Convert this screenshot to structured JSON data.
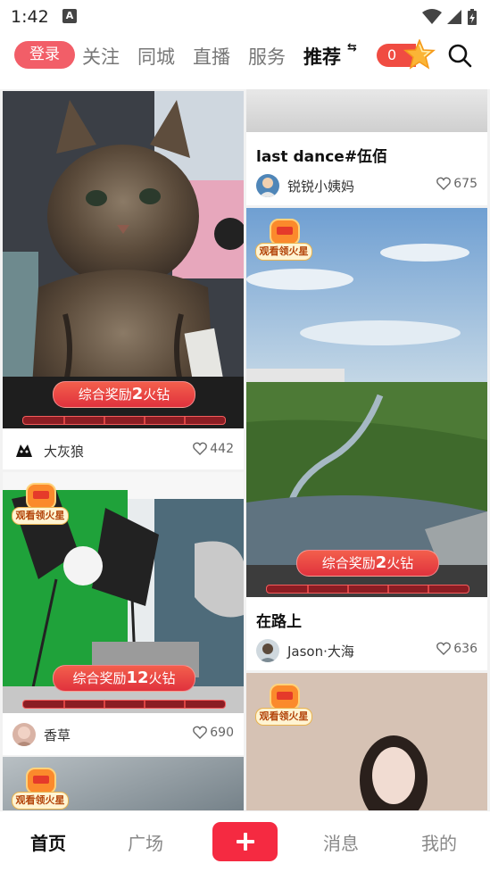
{
  "status_bar": {
    "time": "1:42",
    "notification_glyph": "A"
  },
  "top_nav": {
    "login": "登录",
    "tabs": [
      "关注",
      "同城",
      "直播",
      "服务",
      "推荐"
    ],
    "active_tab": "推荐",
    "swap_glyph": "⇆",
    "points": "0"
  },
  "feed": {
    "left": [
      {
        "reward": {
          "prefix": "综合奖励",
          "amount": "2",
          "suffix": "火钻"
        },
        "author": "大灰狼",
        "likes": "442"
      },
      {
        "badge": "观看领火星",
        "reward": {
          "prefix": "综合奖励",
          "amount": "12",
          "suffix": "火钻"
        },
        "author": "香草",
        "likes": "690"
      },
      {
        "badge": "观看领火星"
      }
    ],
    "right": [
      {
        "title": "last dance#伍佰",
        "author": "锐锐小姨妈",
        "likes": "675"
      },
      {
        "badge": "观看领火星",
        "reward": {
          "prefix": "综合奖励",
          "amount": "2",
          "suffix": "火钻"
        },
        "title": "在路上",
        "author": "Jason·大海",
        "likes": "636"
      },
      {
        "badge": "观看领火星"
      }
    ]
  },
  "bottom_bar": {
    "tabs": [
      "首页",
      "广场",
      "消息",
      "我的"
    ],
    "active": "首页"
  },
  "colors": {
    "accent": "#f52a41",
    "login_bg": "#f25e68",
    "reward": "#e0323d"
  }
}
